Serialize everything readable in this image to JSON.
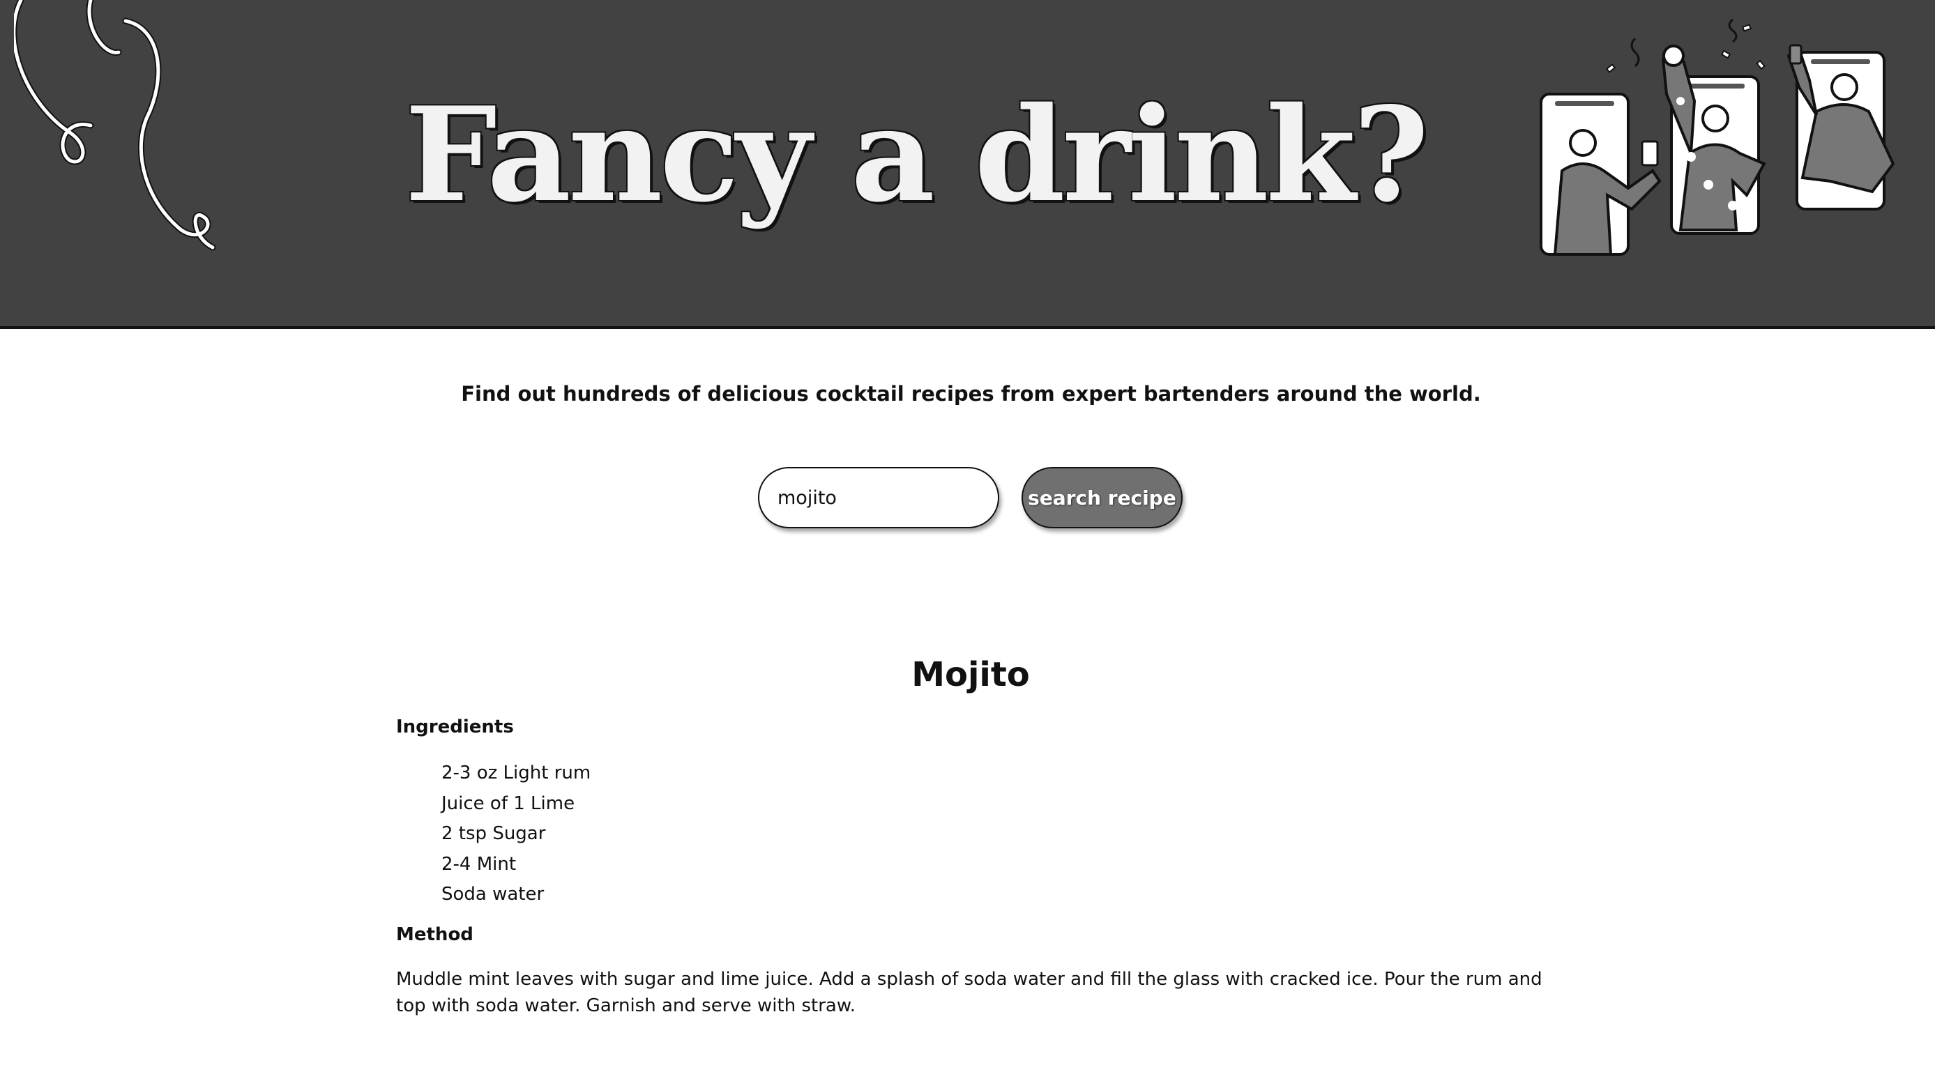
{
  "header": {
    "title": "Fancy a drink?",
    "decoration_icon": "ribbon-doodle-icon",
    "illustration_icon": "people-toasting-phones-illustration"
  },
  "intro": {
    "tagline": "Find out hundreds of delicious cocktail recipes from expert bartenders around the world."
  },
  "search": {
    "value": "mojito",
    "button_label": "search recipe"
  },
  "recipe": {
    "name": "Mojito",
    "ingredients_heading": "Ingredients",
    "ingredients": [
      "2-3 oz Light rum",
      "Juice of 1 Lime",
      "2 tsp Sugar",
      "2-4 Mint",
      "Soda water"
    ],
    "method_heading": "Method",
    "method": "Muddle mint leaves with sugar and lime juice. Add a splash of soda water and fill the glass with cracked ice. Pour the rum and top with soda water. Garnish and serve with straw."
  },
  "colors": {
    "header_bg": "#424242",
    "title_text": "#f2f2f2",
    "button_bg": "#707070",
    "text": "#111111",
    "page_bg": "#ffffff"
  }
}
